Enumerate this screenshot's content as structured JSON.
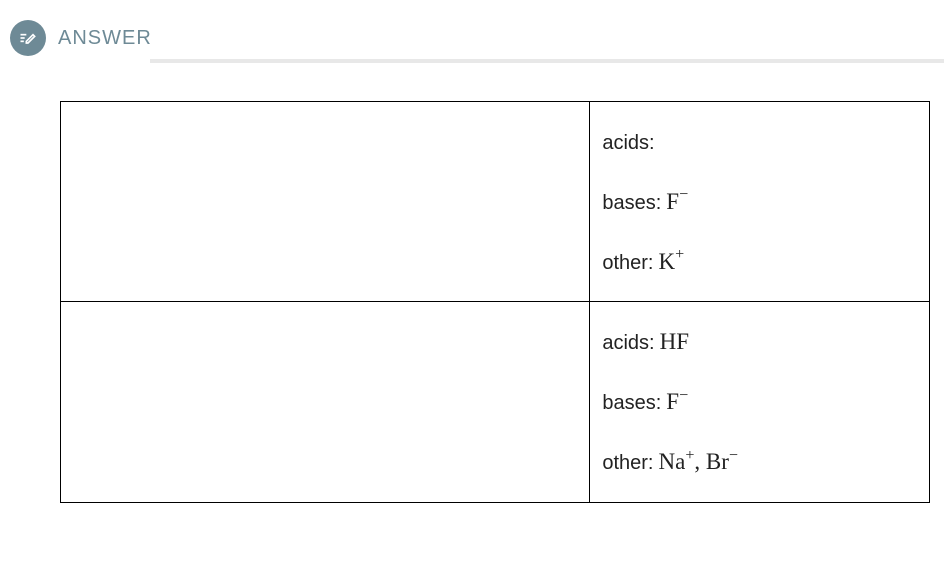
{
  "header": {
    "title": "ANSWER"
  },
  "rows": [
    {
      "left": "",
      "acids_label": "acids:",
      "acids_value": "",
      "bases_label": "bases:",
      "bases_value_html": "F<sup>−</sup>",
      "other_label": "other:",
      "other_value_html": "K<sup>+</sup>"
    },
    {
      "left": "",
      "acids_label": "acids:",
      "acids_value": "HF",
      "bases_label": "bases:",
      "bases_value_html": "F<sup>−</sup>",
      "other_label": "other:",
      "other_value_html": "Na<sup>+</sup>, Br<sup>−</sup>"
    }
  ]
}
